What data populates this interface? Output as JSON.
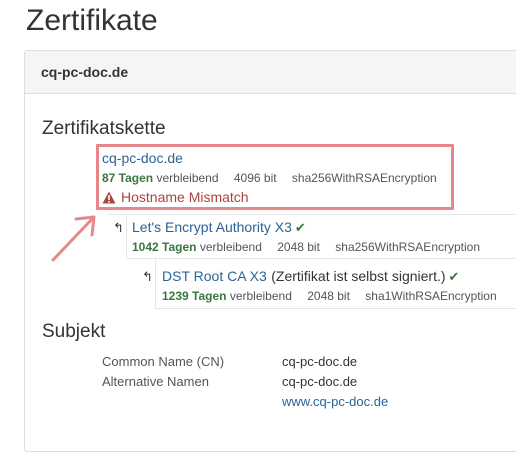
{
  "page": {
    "title": "Zertifikate"
  },
  "panel": {
    "heading": "cq-pc-doc.de"
  },
  "chain": {
    "title": "Zertifikatskette",
    "certs": [
      {
        "name": "cq-pc-doc.de",
        "days": "87 Tagen",
        "remaining": "verbleibend",
        "bits": "4096 bit",
        "algorithm": "sha256WithRSAEncryption",
        "warning": "Hostname Mismatch"
      },
      {
        "name": "Let's Encrypt Authority X3",
        "days": "1042 Tagen",
        "remaining": "verbleibend",
        "bits": "2048 bit",
        "algorithm": "sha256WithRSAEncryption"
      },
      {
        "name": "DST Root CA X3",
        "note": "(Zertifikat ist selbst signiert.)",
        "days": "1239 Tagen",
        "remaining": "verbleibend",
        "bits": "2048 bit",
        "algorithm": "sha1WithRSAEncryption"
      }
    ]
  },
  "subject": {
    "title": "Subjekt",
    "rows": [
      {
        "key": "Common Name (CN)",
        "value": "cq-pc-doc.de"
      },
      {
        "key": "Alternative Namen",
        "value": "cq-pc-doc.de"
      }
    ],
    "link": "www.cq-pc-doc.de"
  },
  "icons": {
    "chain_arrow": "↰",
    "check": "✔"
  },
  "colors": {
    "link": "#2a6496",
    "days": "#3c763d",
    "warning": "#a94442",
    "highlight": "#e8878a"
  }
}
